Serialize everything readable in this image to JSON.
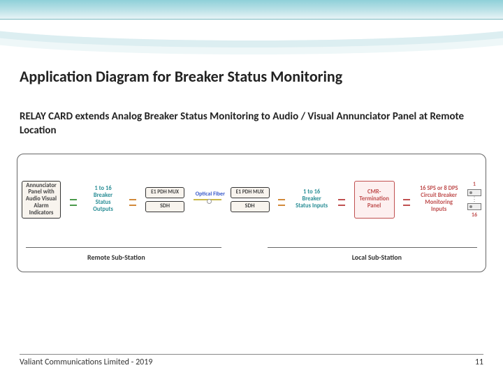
{
  "header": {
    "title": "Application Diagram for Breaker Status Monitoring",
    "subtitle": "RELAY CARD extends Analog Breaker Status Monitoring to Audio / Visual Annunciator Panel at Remote Location"
  },
  "diagram": {
    "annunciator": "Annunciator Panel with Audio Visual Alarm Indicators",
    "breaker_outputs": "1 to 16 Breaker Status Outputs",
    "mux_left_top": "E1 PDH MUX",
    "mux_left_bot": "SDH",
    "optical": "Optical Fiber",
    "mux_right_top": "E1 PDH MUX",
    "mux_right_bot": "SDH",
    "breaker_inputs": "1 to 16 Breaker Status Inputs",
    "cmr": "CMR-Termination Panel",
    "monitor_inputs": "16 SPS or 8 DPS Circuit Breaker Monitoring Inputs",
    "term_top": "1",
    "term_bot": "16",
    "sub_left": "Remote Sub-Station",
    "sub_right": "Local Sub-Station"
  },
  "footer": {
    "company": "Valiant Communications Limited - 2019",
    "page": "11"
  }
}
